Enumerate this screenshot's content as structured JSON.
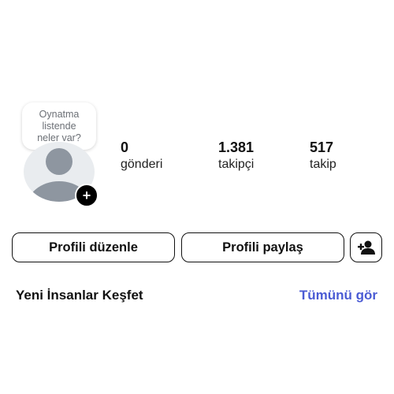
{
  "story_bubble": {
    "lines": [
      "Oynatma",
      "listende",
      "neler var?"
    ]
  },
  "avatar": {
    "add_label": "+"
  },
  "stats": {
    "posts": {
      "value": "0",
      "label": "gönderi"
    },
    "followers": {
      "value": "1.381",
      "label": "takipçi"
    },
    "following": {
      "value": "517",
      "label": "takip"
    }
  },
  "actions": {
    "edit_profile": "Profili düzenle",
    "share_profile": "Profili paylaş",
    "add_person_icon": "person-add-icon"
  },
  "discover": {
    "title": "Yeni İnsanlar Keşfet",
    "see_all": "Tümünü gör",
    "link_color": "#4a5bd4"
  }
}
